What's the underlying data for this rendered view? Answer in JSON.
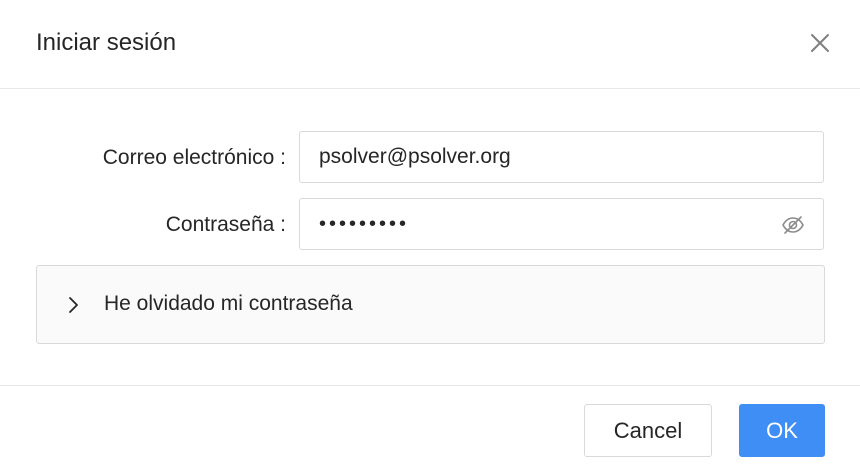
{
  "dialog": {
    "title": "Iniciar sesión",
    "close_icon": "close-icon"
  },
  "form": {
    "email_label": "Correo electrónico :",
    "email_value": "psolver@psolver.org",
    "password_label": "Contraseña :",
    "password_value": "•••••••••",
    "password_toggle_icon": "eye-slash-icon"
  },
  "forgot": {
    "chevron_icon": "chevron-right-icon",
    "label": "He olvidado mi contraseña"
  },
  "footer": {
    "cancel_label": "Cancel",
    "ok_label": "OK"
  },
  "colors": {
    "primary": "#3f8ef5",
    "border": "#d9d9d9",
    "panel_bg": "#fafafa",
    "text": "#262626"
  }
}
